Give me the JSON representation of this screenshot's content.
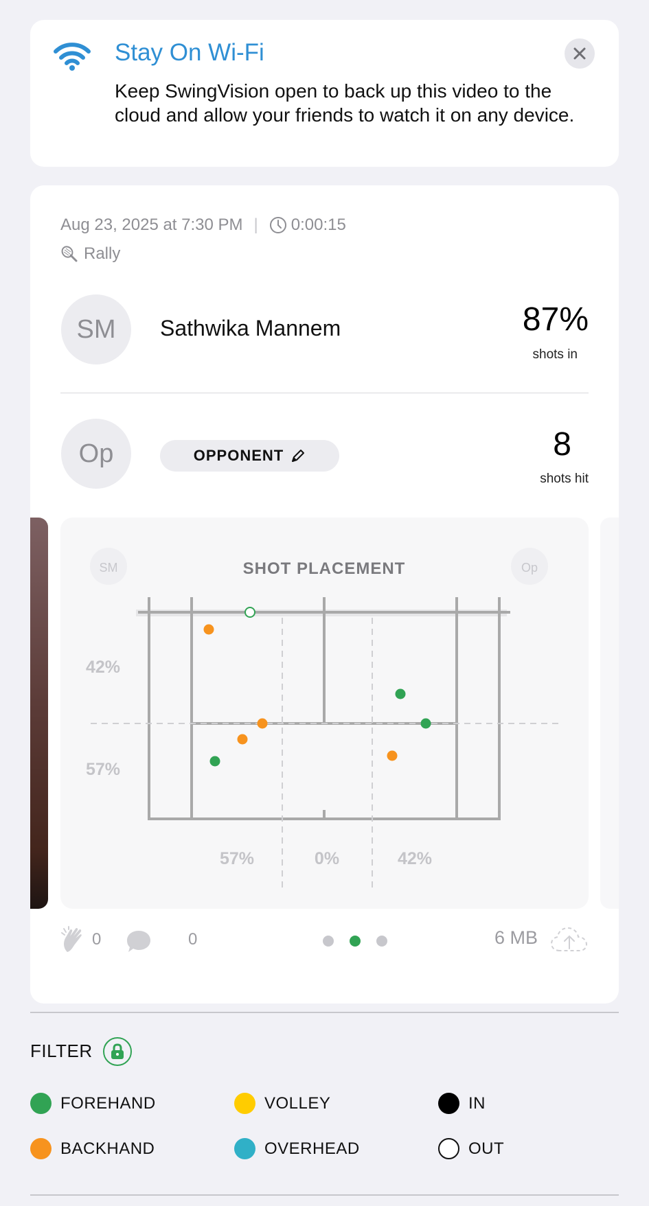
{
  "banner": {
    "title": "Stay On Wi-Fi",
    "body": "Keep SwingVision open to back up this video to the cloud and allow your friends to watch it on any device.",
    "icon": "wifi-icon",
    "close_icon": "close-icon"
  },
  "session": {
    "date": "Aug 23, 2025 at 7:30 PM",
    "duration": "0:00:15",
    "type": "Rally",
    "player": {
      "initials": "SM",
      "name": "Sathwika Mannem",
      "stat_value": "87%",
      "stat_label": "shots in"
    },
    "opponent": {
      "initials": "Op",
      "button_label": "OPPONENT",
      "stat_value": "8",
      "stat_label": "shots hit"
    }
  },
  "shot_chart": {
    "title": "SHOT PLACEMENT",
    "left_initials": "SM",
    "right_initials": "Op",
    "depth_pct": [
      "42%",
      "57%"
    ],
    "width_pct": [
      "57%",
      "0%",
      "42%"
    ],
    "colors": {
      "forehand": "#31a354",
      "backhand": "#f7931e",
      "line": "#a9a9a9"
    }
  },
  "footer": {
    "claps": "0",
    "comments": "0",
    "size": "6 MB",
    "pages": 3,
    "active_page": 1
  },
  "filter": {
    "title": "FILTER",
    "items": [
      {
        "label": "FOREHAND",
        "color": "#31a354"
      },
      {
        "label": "VOLLEY",
        "color": "#ffcc00"
      },
      {
        "label": "IN",
        "color": "#000000"
      },
      {
        "label": "BACKHAND",
        "color": "#f7931e"
      },
      {
        "label": "OVERHEAD",
        "color": "#30b0c7"
      },
      {
        "label": "OUT",
        "color": "#ffffff"
      }
    ]
  }
}
